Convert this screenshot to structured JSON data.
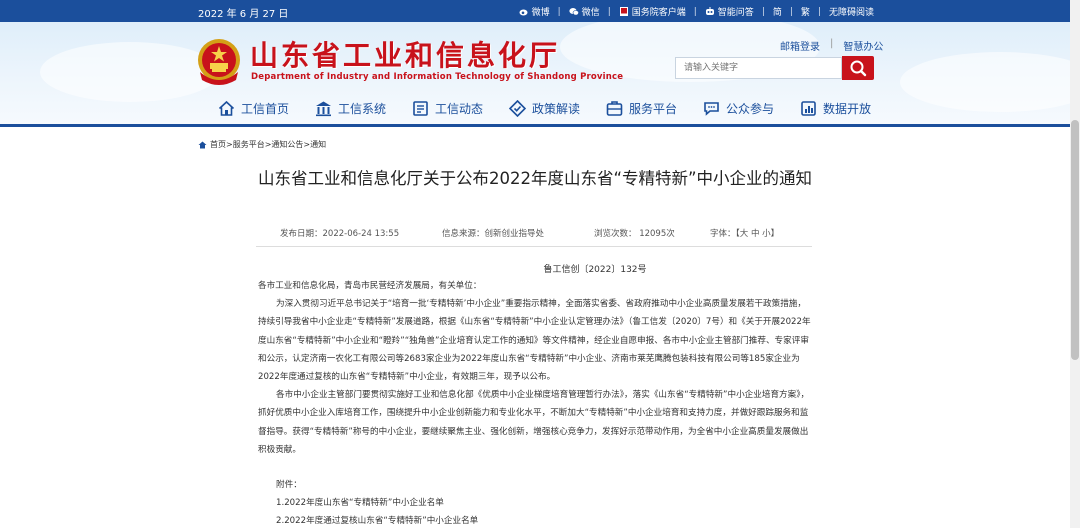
{
  "topbar": {
    "date": "2022 年 6 月 27 日",
    "links": [
      {
        "label": "微博",
        "icon": "weibo-icon"
      },
      {
        "label": "微信",
        "icon": "wechat-icon"
      },
      {
        "label": "国务院客户端",
        "icon": "mobile-client-icon"
      },
      {
        "label": "智能问答",
        "icon": "robot-icon"
      },
      {
        "label": "简",
        "icon": ""
      },
      {
        "label": "繁",
        "icon": ""
      },
      {
        "label": "无障碍阅读",
        "icon": ""
      }
    ]
  },
  "header": {
    "title": "山东省工业和信息化厅",
    "title_en": "Department of Industry and Information Technology of Shandong Province",
    "links": [
      "邮箱登录",
      "智慧办公"
    ],
    "search_placeholder": "请输入关键字"
  },
  "nav": [
    {
      "label": "工信首页",
      "icon": "home-icon"
    },
    {
      "label": "工信系统",
      "icon": "building-icon"
    },
    {
      "label": "工信动态",
      "icon": "news-icon"
    },
    {
      "label": "政策解读",
      "icon": "policy-icon"
    },
    {
      "label": "服务平台",
      "icon": "service-icon"
    },
    {
      "label": "公众参与",
      "icon": "chat-icon"
    },
    {
      "label": "数据开放",
      "icon": "data-icon"
    }
  ],
  "breadcrumb": "首页>服务平台>通知公告>通知",
  "article": {
    "title": "山东省工业和信息化厅关于公布2022年度山东省“专精特新”中小企业的通知",
    "publish_date": "发布日期：2022-06-24 13:55",
    "source": "信息来源：创新创业指导处",
    "views": "浏览次数： 12095次",
    "font_size": "字体：【大 中 小】",
    "doc_number": "鲁工信创〔2022〕132号",
    "salutation": "各市工业和信息化局，青岛市民营经济发展局，有关单位：",
    "paragraphs": [
      "为深入贯彻习近平总书记关于“培育一批‘专精特新’中小企业”重要指示精神，全面落实省委、省政府推动中小企业高质量发展若干政策措施，持续引导我省中小企业走“专精特新”发展道路，根据《山东省“专精特新”中小企业认定管理办法》（鲁工信发〔2020〕7号）和《关于开展2022年度山东省“专精特新”中小企业和“瞪羚”“独角兽”企业培育认定工作的通知》等文件精神，经企业自愿申报、各市中小企业主管部门推荐、专家评审和公示，认定济南一农化工有限公司等2683家企业为2022年度山东省“专精特新”中小企业、济南市莱芜鹰腾包装科技有限公司等185家企业为2022年度通过复核的山东省“专精特新”中小企业，有效期三年，现予以公布。",
      "各市中小企业主管部门要贯彻实施好工业和信息化部《优质中小企业梯度培育管理暂行办法》，落实《山东省“专精特新”中小企业培育方案》，抓好优质中小企业入库培育工作，围绕提升中小企业创新能力和专业化水平，不断加大“专精特新”中小企业培育和支持力度，并做好跟踪服务和监督指导。获得“专精特新”称号的中小企业，要继续聚焦主业、强化创新，增强核心竞争力，发挥好示范带动作用，为全省中小企业高质量发展做出积极贡献。"
    ],
    "attachments_label": "附件：",
    "attachments": [
      "1.2022年度山东省“专精特新”中小企业名单",
      "2.2022年度通过复核山东省“专精特新”中小企业名单"
    ]
  },
  "colors": {
    "brand_blue": "#1b4f9c",
    "brand_red": "#c8121b"
  }
}
